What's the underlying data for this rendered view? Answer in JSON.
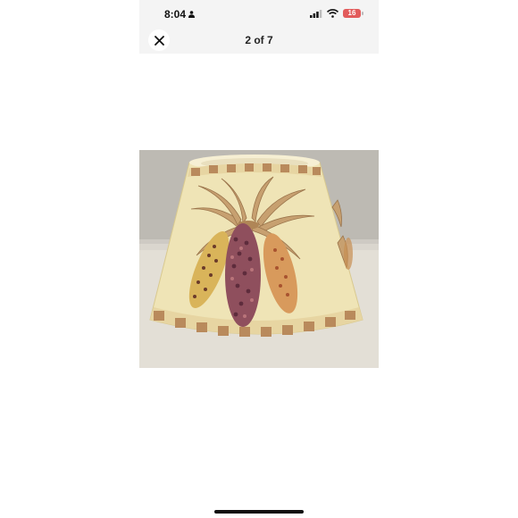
{
  "status_bar": {
    "time": "8:04",
    "battery_level": "16",
    "icons": [
      "person-icon",
      "cellular-signal-icon",
      "wifi-icon",
      "battery-icon"
    ]
  },
  "viewer": {
    "counter": "2 of 7",
    "close_icon": "close-icon"
  },
  "photo": {
    "subject": "ceramic-lamp-shade-with-indian-corn-icon"
  },
  "colors": {
    "topbar_bg": "#f4f4f4",
    "battery_red": "#e25b5b",
    "shade_cream": "#efe3b4",
    "checker_brown": "#b98a5c"
  }
}
